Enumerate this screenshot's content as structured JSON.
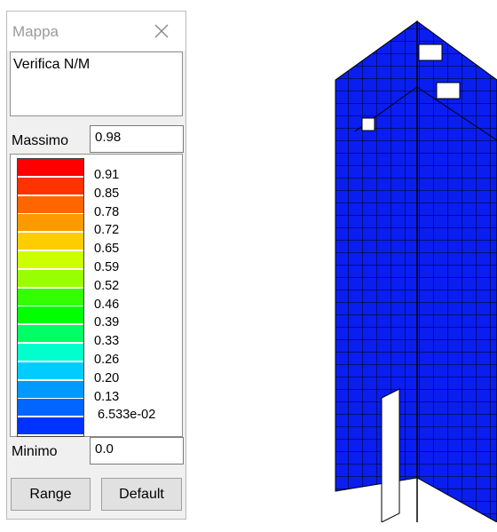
{
  "window": {
    "title": "Mappa"
  },
  "description": "Verifica N/M",
  "max": {
    "label": "Massimo",
    "value": "0.98"
  },
  "min": {
    "label": "Minimo",
    "value": "0.0"
  },
  "legend": {
    "ticks": [
      "0.91",
      "0.85",
      "0.78",
      "0.72",
      "0.65",
      "0.59",
      "0.52",
      "0.46",
      "0.39",
      "0.33",
      "0.26",
      "0.20",
      "0.13",
      "6.533e-02"
    ],
    "colors": [
      "#ff0000",
      "#ff3300",
      "#ff6600",
      "#ff9900",
      "#ffcc00",
      "#ccff00",
      "#99ff00",
      "#33ff00",
      "#00ff00",
      "#00ff66",
      "#00ffcc",
      "#00ccff",
      "#0099ff",
      "#0066ff",
      "#0033ff"
    ]
  },
  "buttons": {
    "range": "Range",
    "default": "Default"
  },
  "model": {
    "color": "#0a1ef0"
  }
}
